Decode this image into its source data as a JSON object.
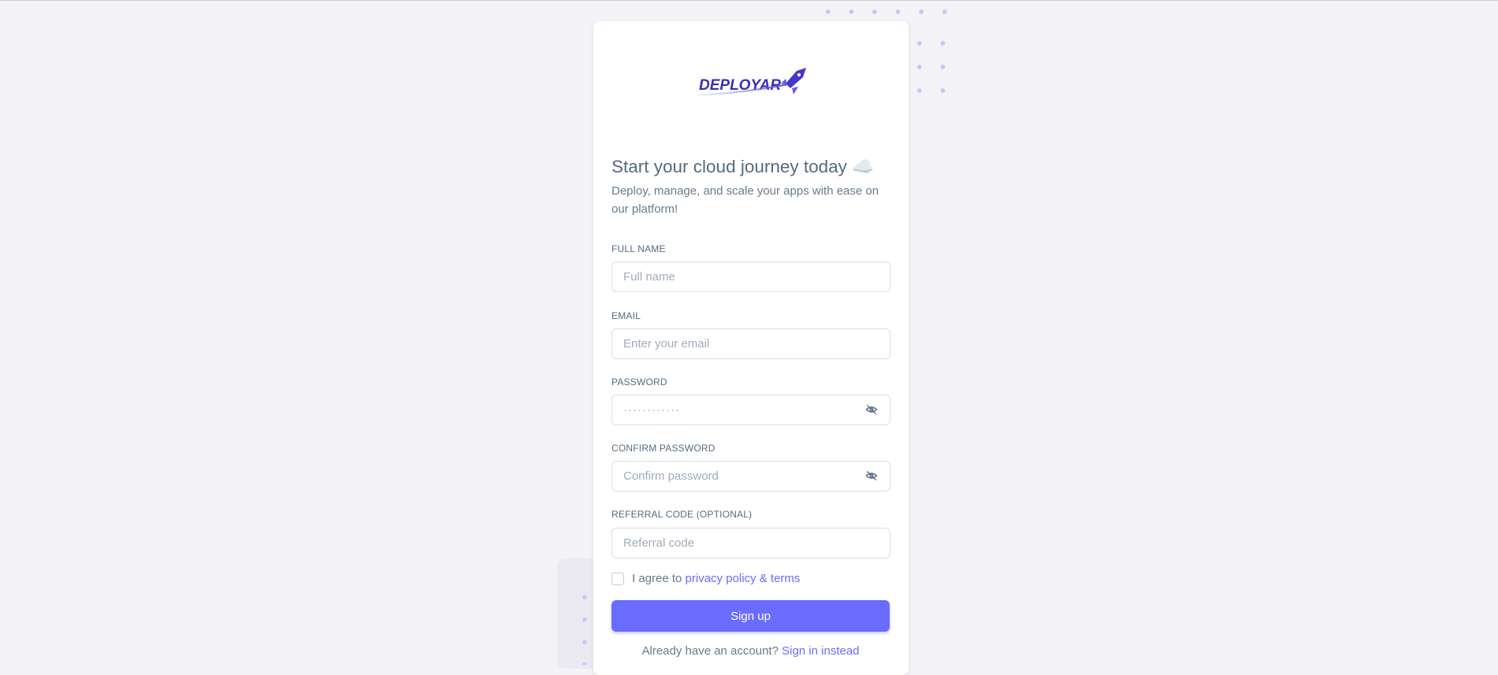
{
  "brand": {
    "logo_text": "DEPLOYAR",
    "logo_color": "#3b2db5",
    "accent": "#696cff"
  },
  "header": {
    "title": "Start your cloud journey today ☁️",
    "subtitle": "Deploy, manage, and scale your apps with ease on our platform!"
  },
  "form": {
    "full_name": {
      "label": "FULL NAME",
      "placeholder": "Full name",
      "value": ""
    },
    "email": {
      "label": "EMAIL",
      "placeholder": "Enter your email",
      "value": ""
    },
    "password": {
      "label": "PASSWORD",
      "placeholder": "············",
      "value": "",
      "toggle_icon": "eye-off-icon"
    },
    "confirm_password": {
      "label": "CONFIRM PASSWORD",
      "placeholder": "Confirm password",
      "value": "",
      "toggle_icon": "eye-off-icon"
    },
    "referral": {
      "label": "REFERRAL CODE (OPTIONAL)",
      "placeholder": "Referral code",
      "value": ""
    },
    "agree": {
      "prefix": "I agree to ",
      "link": "privacy policy & terms",
      "checked": false
    },
    "submit_label": "Sign up"
  },
  "footer": {
    "prompt": "Already have an account? ",
    "link": "Sign in instead"
  }
}
